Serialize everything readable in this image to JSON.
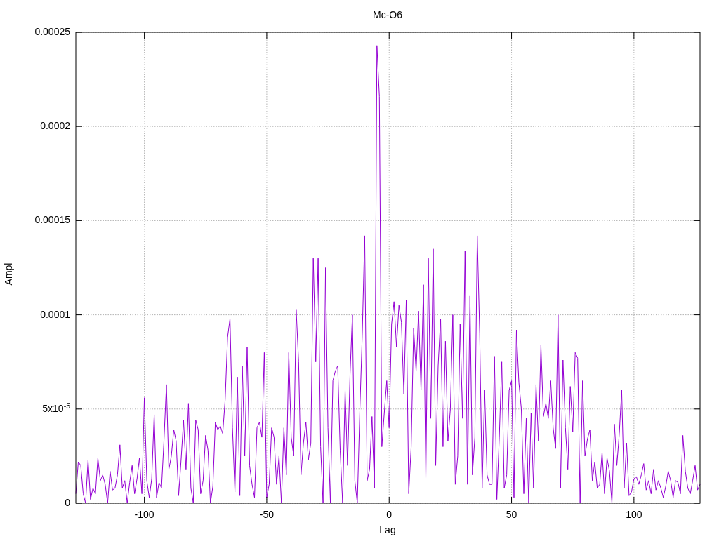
{
  "chart_data": {
    "type": "line",
    "title": "Mc-O6",
    "xlabel": "Lag",
    "ylabel": "Ampl",
    "grid": true,
    "xlim": [
      -128,
      127
    ],
    "ylim": [
      0,
      0.00025
    ],
    "xticks": [
      -100,
      -50,
      0,
      50,
      100
    ],
    "yticks": [
      {
        "value": 0,
        "label": "0"
      },
      {
        "value": 5e-05,
        "label": "5x10$^{-5}$"
      },
      {
        "value": 0.0001,
        "label": "0.0001"
      },
      {
        "value": 0.00015,
        "label": "0.00015"
      },
      {
        "value": 0.0002,
        "label": "0.0002"
      },
      {
        "value": 0.00025,
        "label": "0.00025"
      }
    ],
    "x": [
      -128,
      -127,
      -126,
      -125,
      -124,
      -123,
      -122,
      -121,
      -120,
      -119,
      -118,
      -117,
      -116,
      -115,
      -114,
      -113,
      -112,
      -111,
      -110,
      -109,
      -108,
      -107,
      -106,
      -105,
      -104,
      -103,
      -102,
      -101,
      -100,
      -99,
      -98,
      -97,
      -96,
      -95,
      -94,
      -93,
      -92,
      -91,
      -90,
      -89,
      -88,
      -87,
      -86,
      -85,
      -84,
      -83,
      -82,
      -81,
      -80,
      -79,
      -78,
      -77,
      -76,
      -75,
      -74,
      -73,
      -72,
      -71,
      -70,
      -69,
      -68,
      -67,
      -66,
      -65,
      -64,
      -63,
      -62,
      -61,
      -60,
      -59,
      -58,
      -57,
      -56,
      -55,
      -54,
      -53,
      -52,
      -51,
      -50,
      -49,
      -48,
      -47,
      -46,
      -45,
      -44,
      -43,
      -42,
      -41,
      -40,
      -39,
      -38,
      -37,
      -36,
      -35,
      -34,
      -33,
      -32,
      -31,
      -30,
      -29,
      -28,
      -27,
      -26,
      -25,
      -24,
      -23,
      -22,
      -21,
      -20,
      -19,
      -18,
      -17,
      -16,
      -15,
      -14,
      -13,
      -12,
      -11,
      -10,
      -9,
      -8,
      -7,
      -6,
      -5,
      -4,
      -3,
      -2,
      -1,
      0,
      1,
      2,
      3,
      4,
      5,
      6,
      7,
      8,
      9,
      10,
      11,
      12,
      13,
      14,
      15,
      16,
      17,
      18,
      19,
      20,
      21,
      22,
      23,
      24,
      25,
      26,
      27,
      28,
      29,
      30,
      31,
      32,
      33,
      34,
      35,
      36,
      37,
      38,
      39,
      40,
      41,
      42,
      43,
      44,
      45,
      46,
      47,
      48,
      49,
      50,
      51,
      52,
      53,
      54,
      55,
      56,
      57,
      58,
      59,
      60,
      61,
      62,
      63,
      64,
      65,
      66,
      67,
      68,
      69,
      70,
      71,
      72,
      73,
      74,
      75,
      76,
      77,
      78,
      79,
      80,
      81,
      82,
      83,
      84,
      85,
      86,
      87,
      88,
      89,
      90,
      91,
      92,
      93,
      94,
      95,
      96,
      97,
      98,
      99,
      100,
      101,
      102,
      103,
      104,
      105,
      106,
      107,
      108,
      109,
      110,
      111,
      112,
      113,
      114,
      115,
      116,
      117,
      118,
      119,
      120,
      121,
      122,
      123,
      124,
      125,
      126,
      127
    ],
    "series": [
      {
        "color": "#9400d3",
        "values": [
          5e-06,
          2.2e-05,
          2e-05,
          5e-06,
          0,
          2.3e-05,
          2e-06,
          8e-06,
          5e-06,
          2.4e-05,
          1.2e-05,
          1.5e-05,
          1e-05,
          0,
          1.7e-05,
          7e-06,
          8e-06,
          1.5e-05,
          3.1e-05,
          8e-06,
          1.2e-05,
          0,
          1.1e-05,
          2e-05,
          5e-06,
          1.3e-05,
          2.4e-05,
          5e-06,
          5.6e-05,
          1.2e-05,
          3e-06,
          1.3e-05,
          4.7e-05,
          3e-06,
          1.1e-05,
          8e-06,
          3.3e-05,
          6.3e-05,
          1.8e-05,
          2.5e-05,
          3.9e-05,
          3.3e-05,
          4e-06,
          2.3e-05,
          4.4e-05,
          1.8e-05,
          5.3e-05,
          8e-06,
          0,
          4.4e-05,
          3.9e-05,
          5e-06,
          1.2e-05,
          3.6e-05,
          2.8e-05,
          0,
          9e-06,
          4.3e-05,
          3.9e-05,
          4.1e-05,
          3.7e-05,
          5.5e-05,
          8.8e-05,
          9.8e-05,
          4e-05,
          6e-06,
          6.7e-05,
          4e-06,
          7.3e-05,
          2.5e-05,
          8.3e-05,
          2e-05,
          1e-05,
          3e-06,
          4e-05,
          4.3e-05,
          3.5e-05,
          8e-05,
          3e-06,
          1e-05,
          4e-05,
          3.5e-05,
          1e-05,
          2.5e-05,
          0,
          4e-05,
          1.5e-05,
          8e-05,
          3.5e-05,
          2.5e-05,
          0.000103,
          7.5e-05,
          1.5e-05,
          3.2e-05,
          4.3e-05,
          2.3e-05,
          3.2e-05,
          0.00013,
          7.5e-05,
          0.00013,
          3e-05,
          0,
          0.000125,
          4e-05,
          0,
          6.5e-05,
          7e-05,
          7.3e-05,
          2.8e-05,
          0,
          6e-05,
          2e-05,
          6.8e-05,
          0.0001,
          1.2e-05,
          0,
          4.8e-05,
          8.9e-05,
          0.000142,
          1.2e-05,
          1.8e-05,
          4.6e-05,
          8e-06,
          0.000243,
          0.000216,
          3e-05,
          4.8e-05,
          6.5e-05,
          4e-05,
          9.5e-05,
          0.000107,
          8.3e-05,
          0.000105,
          9.6e-05,
          5.8e-05,
          0.000108,
          5e-06,
          3e-05,
          9.3e-05,
          7e-05,
          0.000102,
          6e-05,
          0.000116,
          1.3e-05,
          0.00013,
          4.5e-05,
          0.000135,
          2e-05,
          7.3e-05,
          9.8e-05,
          3e-05,
          8.6e-05,
          3.3e-05,
          5e-05,
          0.0001,
          1e-05,
          2.5e-05,
          9.5e-05,
          4.5e-05,
          0.000134,
          1e-05,
          0.00011,
          1.5e-05,
          3.5e-05,
          0.000142,
          9e-05,
          8e-06,
          6e-05,
          1.5e-05,
          1e-05,
          1e-05,
          7.8e-05,
          2e-06,
          3.5e-05,
          7.5e-05,
          8e-06,
          1.5e-05,
          6e-05,
          6.5e-05,
          3e-06,
          9.2e-05,
          6.4e-05,
          5e-05,
          5e-06,
          4.5e-05,
          0,
          4.8e-05,
          8e-06,
          6.3e-05,
          3.3e-05,
          8.4e-05,
          4.6e-05,
          5.3e-05,
          4.5e-05,
          6.5e-05,
          4e-05,
          2.9e-05,
          0.0001,
          8e-06,
          7.6e-05,
          4e-05,
          1.8e-05,
          6.2e-05,
          3.8e-05,
          8e-05,
          7.7e-05,
          0,
          6.5e-05,
          2.5e-05,
          3.4e-05,
          3.9e-05,
          1.2e-05,
          2.2e-05,
          8e-06,
          1e-05,
          2.7e-05,
          5e-06,
          2.4e-05,
          1.7e-05,
          0,
          4.2e-05,
          2e-05,
          3.7e-05,
          6e-05,
          8e-06,
          3.2e-05,
          4e-06,
          6e-06,
          1.3e-05,
          1.4e-05,
          1e-05,
          1.5e-05,
          2.1e-05,
          7e-06,
          1.2e-05,
          5e-06,
          1.8e-05,
          7e-06,
          1.2e-05,
          8e-06,
          3e-06,
          9e-06,
          1.7e-05,
          1.2e-05,
          3e-06,
          1.2e-05,
          1.1e-05,
          5e-06,
          3.6e-05,
          1.7e-05,
          8e-06,
          5e-06,
          1.2e-05,
          2e-05,
          7e-06,
          1e-05
        ]
      }
    ]
  }
}
